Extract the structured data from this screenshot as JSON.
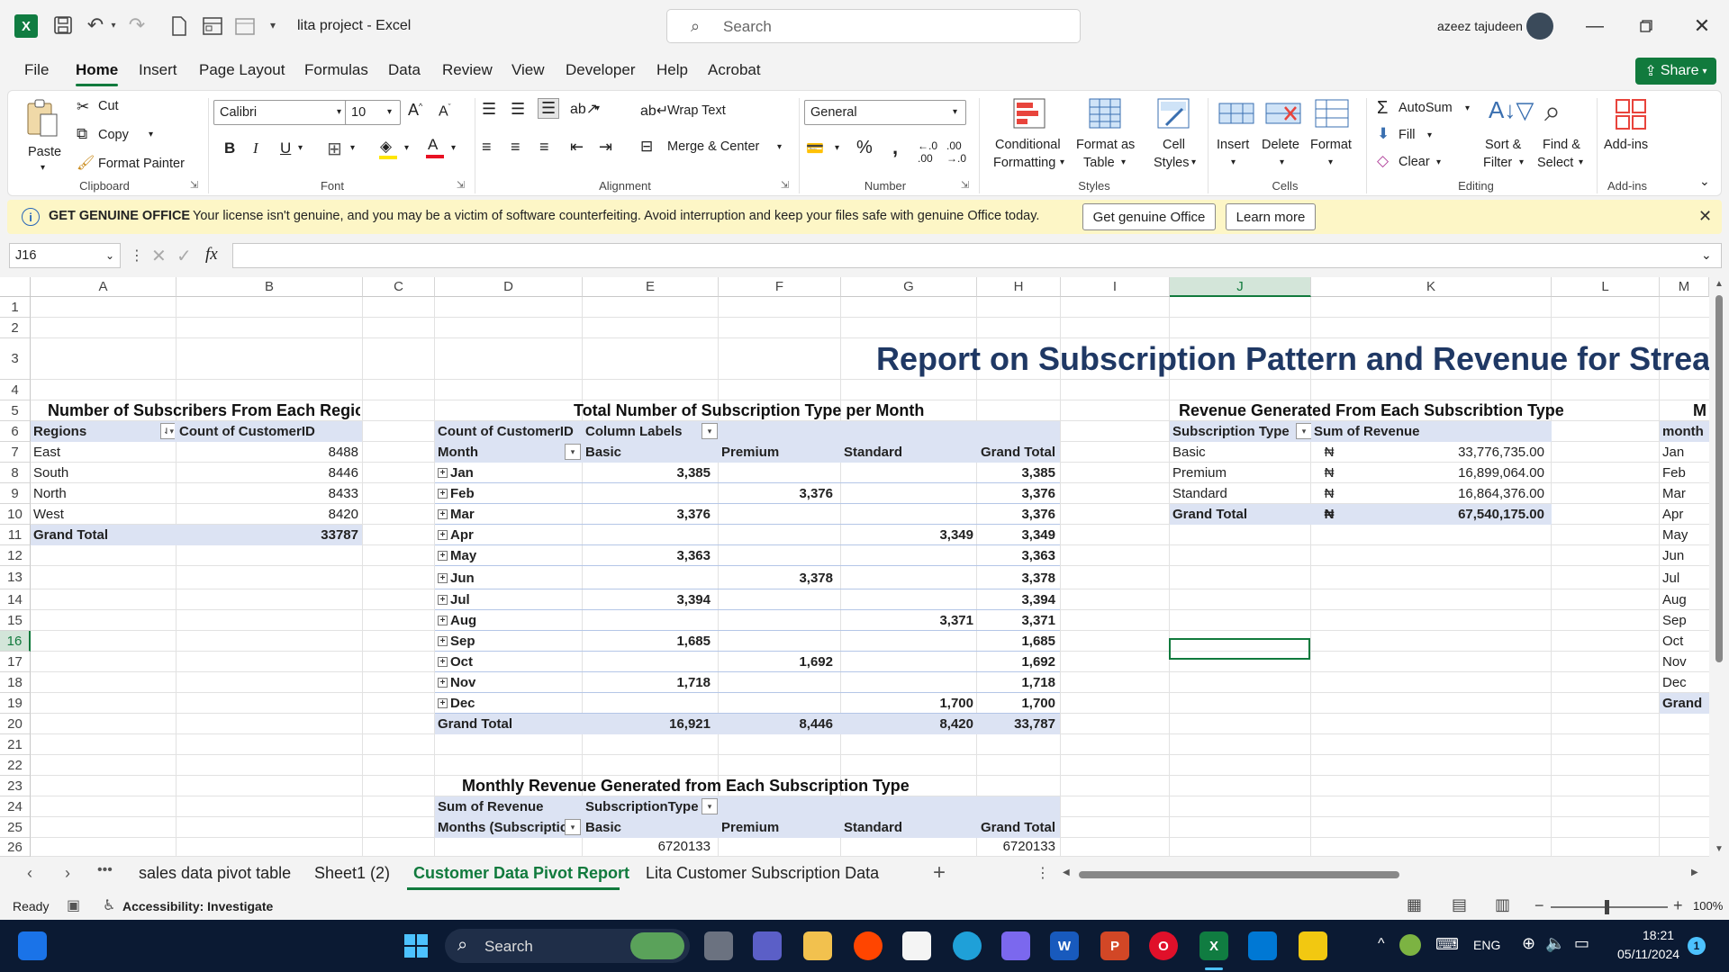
{
  "titlebar": {
    "doc_title": "lita project  -  Excel",
    "search_placeholder": "Search",
    "user_name": "azeez tajudeen"
  },
  "menu": [
    "File",
    "Home",
    "Insert",
    "Page Layout",
    "Formulas",
    "Data",
    "Review",
    "View",
    "Developer",
    "Help",
    "Acrobat"
  ],
  "share_label": "Share",
  "ribbon": {
    "clipboard": {
      "paste": "Paste",
      "cut": "Cut",
      "copy": "Copy",
      "format_painter": "Format Painter",
      "group": "Clipboard"
    },
    "font": {
      "name": "Calibri",
      "size": "10",
      "group": "Font",
      "bold": "B",
      "italic": "I",
      "underline": "U"
    },
    "alignment": {
      "wrap": "Wrap Text",
      "merge": "Merge & Center",
      "group": "Alignment"
    },
    "number": {
      "format": "General",
      "group": "Number"
    },
    "styles": {
      "cond": "Conditional",
      "cond2": "Formatting",
      "fmt_table": "Format as",
      "fmt_table2": "Table",
      "cell": "Cell",
      "cell2": "Styles",
      "group": "Styles"
    },
    "cells": {
      "insert": "Insert",
      "delete": "Delete",
      "format": "Format",
      "group": "Cells"
    },
    "editing": {
      "autosum": "AutoSum",
      "fill": "Fill",
      "clear": "Clear",
      "sort": "Sort &",
      "sort2": "Filter",
      "find": "Find &",
      "find2": "Select",
      "group": "Editing"
    },
    "addins": {
      "label": "Add-ins",
      "group": "Add-ins"
    }
  },
  "notification": {
    "title": "GET GENUINE OFFICE",
    "message": "Your license isn't genuine, and you may be a victim of software counterfeiting. Avoid interruption and keep your files safe with genuine Office today.",
    "btn_get": "Get genuine Office",
    "btn_learn": "Learn more"
  },
  "formula_bar": {
    "name_box": "J16",
    "fx": "fx",
    "value": ""
  },
  "columns": [
    "A",
    "B",
    "C",
    "D",
    "E",
    "F",
    "G",
    "H",
    "I",
    "J",
    "K",
    "L",
    "M"
  ],
  "rows": [
    "1",
    "2",
    "3",
    "4",
    "5",
    "6",
    "7",
    "8",
    "9",
    "10",
    "11",
    "12",
    "13",
    "14",
    "15",
    "16",
    "17",
    "18",
    "19",
    "20",
    "21",
    "22",
    "23",
    "24",
    "25",
    "26"
  ],
  "report_title": "Report on Subscription Pattern and Revenue for  Stream",
  "region_pivot": {
    "title": "Number of Subscribers From Each Region",
    "h1": "Regions",
    "h2": "Count of CustomerID",
    "rows": [
      [
        "East",
        "8488"
      ],
      [
        "South",
        "8446"
      ],
      [
        "North",
        "8433"
      ],
      [
        "West",
        "8420"
      ]
    ],
    "total": [
      "Grand Total",
      "33787"
    ]
  },
  "month_pivot": {
    "title": "Total Number of Subscription Type per Month",
    "count_label": "Count of CustomerID",
    "col_labels": "Column Labels",
    "month_label": "Month",
    "types": [
      "Basic",
      "Premium",
      "Standard",
      "Grand Total"
    ],
    "rows": [
      [
        "Jan",
        "3,385",
        "",
        "",
        "3,385"
      ],
      [
        "Feb",
        "",
        "3,376",
        "",
        "3,376"
      ],
      [
        "Mar",
        "3,376",
        "",
        "",
        "3,376"
      ],
      [
        "Apr",
        "",
        "",
        "3,349",
        "3,349"
      ],
      [
        "May",
        "3,363",
        "",
        "",
        "3,363"
      ],
      [
        "Jun",
        "",
        "3,378",
        "",
        "3,378"
      ],
      [
        "Jul",
        "3,394",
        "",
        "",
        "3,394"
      ],
      [
        "Aug",
        "",
        "",
        "3,371",
        "3,371"
      ],
      [
        "Sep",
        "1,685",
        "",
        "",
        "1,685"
      ],
      [
        "Oct",
        "",
        "1,692",
        "",
        "1,692"
      ],
      [
        "Nov",
        "1,718",
        "",
        "",
        "1,718"
      ],
      [
        "Dec",
        "",
        "",
        "1,700",
        "1,700"
      ]
    ],
    "total": [
      "Grand Total",
      "16,921",
      "8,446",
      "8,420",
      "33,787"
    ],
    "expand_glyph": "+"
  },
  "revenue_pivot": {
    "title": "Revenue Generated From Each Subscribtion Type",
    "h1": "Subscription Type",
    "h2": "Sum of Revenue",
    "currency": "₦",
    "rows": [
      [
        "Basic",
        "33,776,735.00"
      ],
      [
        "Premium",
        "16,899,064.00"
      ],
      [
        "Standard",
        "16,864,376.00"
      ]
    ],
    "total": [
      "Grand Total",
      "67,540,175.00"
    ]
  },
  "right_pivot": {
    "title": "M",
    "header": "month",
    "rows": [
      "Jan",
      "Feb",
      "Mar",
      "Apr",
      "May",
      "Jun",
      "Jul",
      "Aug",
      "Sep",
      "Oct",
      "Nov",
      "Dec"
    ],
    "total": "Grand"
  },
  "monthly_revenue_pivot": {
    "title": "Monthly Revenue Generated from Each Subscription Type",
    "sum_label": "Sum of Revenue",
    "type_label": "SubscriptionType",
    "months_label": "Months (Subscriptic",
    "types": [
      "Basic",
      "Premium",
      "Standard",
      "Grand Total"
    ],
    "partial_row": [
      "6720133",
      "6720133"
    ]
  },
  "sheet_tabs": [
    "sales data pivot table",
    "Sheet1 (2)",
    "Customer Data Pivot Report",
    "Lita Customer Subscription Data"
  ],
  "active_tab": "Customer Data Pivot Report",
  "status": {
    "ready": "Ready",
    "accessibility": "Accessibility: Investigate",
    "zoom": "100%"
  },
  "taskbar": {
    "search": "Search",
    "lang": "ENG",
    "time": "18:21",
    "date": "05/11/2024",
    "badge": "1"
  },
  "colors": {
    "excel_green": "#117a3d",
    "pivot_header": "#dce3f3",
    "title_blue": "#1f3864",
    "banner": "#fdf6c6"
  }
}
